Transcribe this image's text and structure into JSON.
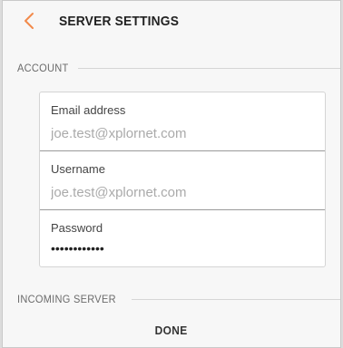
{
  "header": {
    "title": "SERVER SETTINGS",
    "back_icon": "chevron-left-icon",
    "accent_color": "#f28a4b"
  },
  "account": {
    "section_label": "ACCOUNT",
    "email": {
      "label": "Email address",
      "value": "",
      "placeholder": "joe.test@xplornet.com"
    },
    "username": {
      "label": "Username",
      "value": "",
      "placeholder": "joe.test@xplornet.com"
    },
    "password": {
      "label": "Password",
      "value": "••••••••••••"
    }
  },
  "incoming": {
    "section_label": "INCOMING SERVER"
  },
  "footer": {
    "done_label": "DONE"
  }
}
